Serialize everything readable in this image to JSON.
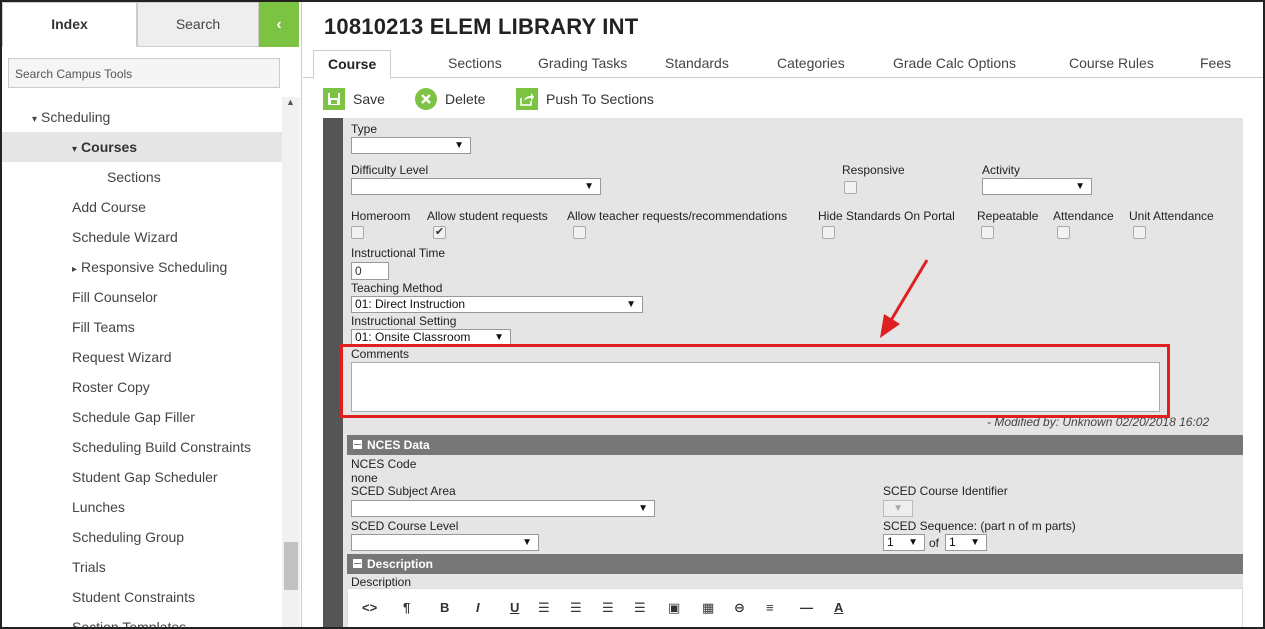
{
  "sidebar": {
    "tab_index": "Index",
    "tab_search": "Search",
    "collapse_glyph": "‹",
    "search_placeholder": "Search Campus Tools",
    "items": [
      {
        "label": "Scheduling",
        "level": "l0",
        "expanded": true
      },
      {
        "label": "Courses",
        "level": "l1",
        "expanded": true
      },
      {
        "label": "Sections",
        "level": "l2"
      },
      {
        "label": "Add Course",
        "level": "l1"
      },
      {
        "label": "Schedule Wizard",
        "level": "l1"
      },
      {
        "label": "Responsive Scheduling",
        "level": "l1",
        "collapsed": true
      },
      {
        "label": "Fill Counselor",
        "level": "l1"
      },
      {
        "label": "Fill Teams",
        "level": "l1"
      },
      {
        "label": "Request Wizard",
        "level": "l1"
      },
      {
        "label": "Roster Copy",
        "level": "l1"
      },
      {
        "label": "Schedule Gap Filler",
        "level": "l1"
      },
      {
        "label": "Scheduling Build Constraints",
        "level": "l1"
      },
      {
        "label": "Student Gap Scheduler",
        "level": "l1"
      },
      {
        "label": "Lunches",
        "level": "l1"
      },
      {
        "label": "Scheduling Group",
        "level": "l1"
      },
      {
        "label": "Trials",
        "level": "l1"
      },
      {
        "label": "Student Constraints",
        "level": "l1"
      },
      {
        "label": "Section Templates",
        "level": "l1"
      }
    ]
  },
  "header": {
    "title": "10810213 ELEM LIBRARY INT"
  },
  "tabs": [
    "Course",
    "Sections",
    "Grading Tasks",
    "Standards",
    "Categories",
    "Grade Calc Options",
    "Course Rules",
    "Fees"
  ],
  "toolbar": {
    "save": "Save",
    "delete": "Delete",
    "push": "Push To Sections"
  },
  "form": {
    "type_label": "Type",
    "difficulty_label": "Difficulty Level",
    "responsive_label": "Responsive",
    "activity_label": "Activity",
    "homeroom_label": "Homeroom",
    "allow_student_label": "Allow student requests",
    "allow_teacher_label": "Allow teacher requests/recommendations",
    "hide_standards_label": "Hide Standards On Portal",
    "repeatable_label": "Repeatable",
    "attendance_label": "Attendance",
    "unit_attendance_label": "Unit Attendance",
    "instructional_time_label": "Instructional Time",
    "instructional_time_value": "0",
    "teaching_method_label": "Teaching Method",
    "teaching_method_value": "01: Direct Instruction",
    "instructional_setting_label": "Instructional Setting",
    "instructional_setting_value": "01: Onsite Classroom",
    "comments_label": "Comments",
    "modified": "- Modified by: Unknown 02/20/2018 16:02"
  },
  "nces": {
    "header": "NCES Data",
    "code_label": "NCES Code",
    "code_value": "none",
    "subject_label": "SCED Subject Area",
    "identifier_label": "SCED Course Identifier",
    "level_label": "SCED Course Level",
    "sequence_label": "SCED Sequence: (part n of m parts)",
    "seq_n": "1",
    "seq_of": "of",
    "seq_m": "1"
  },
  "description": {
    "header": "Description",
    "label": "Description"
  },
  "editor_icons": [
    "<>",
    "¶",
    "B",
    "I",
    "U",
    "☰",
    "☰",
    "☰",
    "☰",
    "▣",
    "▦",
    "⊖",
    "≡",
    "—",
    "A"
  ],
  "colors": {
    "accent": "#7cc243",
    "highlight": "#e02020",
    "section_header": "#777777"
  }
}
